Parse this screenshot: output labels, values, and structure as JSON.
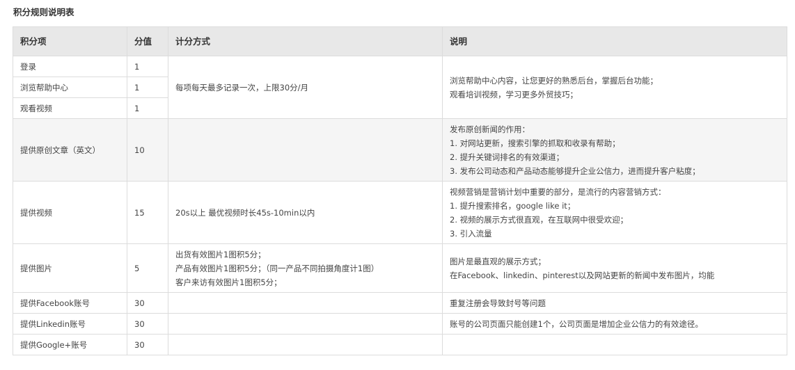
{
  "title": "积分规则说明表",
  "headers": {
    "item": "积分项",
    "points": "分值",
    "method": "计分方式",
    "desc": "说明"
  },
  "rows": [
    {
      "item": "登录",
      "points": "1"
    },
    {
      "item": "浏览帮助中心",
      "points": "1"
    },
    {
      "item": "观看视频",
      "points": "1"
    },
    {
      "item": "提供原创文章（英文）",
      "points": "10",
      "method": "",
      "desc": "发布原创新闻的作用：\n1. 对网站更新，搜索引擎的抓取和收录有帮助；\n2. 提升关键词排名的有效渠道；\n3. 发布公司动态和产品动态能够提升企业公信力，进而提升客户粘度；"
    },
    {
      "item": "提供视频",
      "points": "15",
      "method": "20s以上 最优视频时长45s-10min以内",
      "desc": "视频营销是营销计划中重要的部分，是流行的内容营销方式：\n1. 提升搜索排名，google like it；\n2. 视频的展示方式很直观，在互联网中很受欢迎；\n3. 引入流量"
    },
    {
      "item": "提供图片",
      "points": "5",
      "method": "出货有效图片1图积5分；\n产品有效图片1图积5分；（同一产品不同拍摄角度计1图）\n客户来访有效图片1图积5分；",
      "desc": "图片是最直观的展示方式；\n在Facebook、linkedin、pinterest以及网站更新的新闻中发布图片，均能"
    },
    {
      "item": "提供Facebook账号",
      "points": "30",
      "method": "",
      "desc": "重复注册会导致封号等问题"
    },
    {
      "item": "提供Linkedin账号",
      "points": "30",
      "method": "",
      "desc": "账号的公司页面只能创建1个，公司页面是增加企业公信力的有效途径。"
    },
    {
      "item": "提供Google+账号",
      "points": "30",
      "method": "",
      "desc": ""
    }
  ],
  "group1": {
    "method": "每项每天最多记录一次，上限30分/月",
    "desc": "浏览帮助中心内容，让您更好的熟悉后台，掌握后台功能；\n观看培训视频，学习更多外贸技巧；"
  }
}
